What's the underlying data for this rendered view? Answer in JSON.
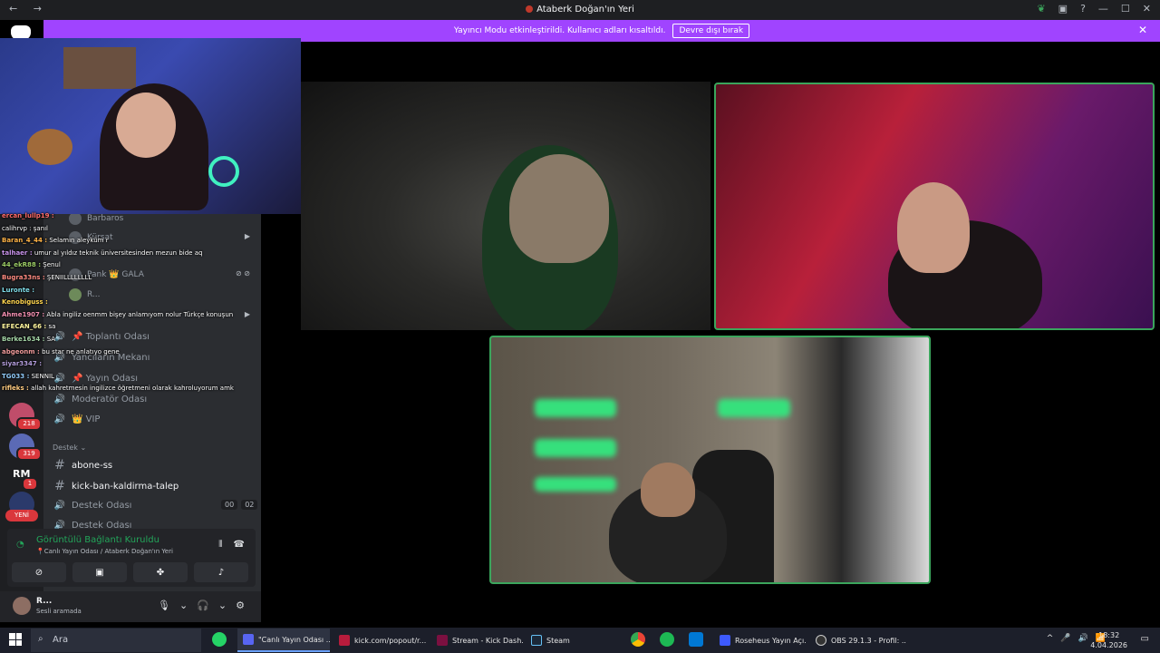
{
  "window": {
    "title": "Ataberk Doğan'ın Yeri",
    "nav_back": "←",
    "nav_forward": "→",
    "controls": [
      "—",
      "☐",
      "✕"
    ]
  },
  "banner": {
    "message": "Yayıncı Modu etkinleştirildi. Kullanıcı adları kısaltıldı.",
    "button": "Devre dışı bırak",
    "close": "✕"
  },
  "server_rail": {
    "badges": [
      "218",
      "319",
      "1"
    ],
    "text_icon": "RM",
    "new_label": "YENİ"
  },
  "channels": {
    "voice_users": [
      {
        "name": "Barbaros"
      },
      {
        "name": "Kürşat"
      },
      {
        "name": "Pank 👑 GALA"
      },
      {
        "name": "R..."
      }
    ],
    "voice_channels_upper": [
      {
        "label": "📌 Toplantı Odası"
      },
      {
        "label": "Yancıların Mekanı"
      },
      {
        "label": "📌 Yayın Odası"
      },
      {
        "label": "Moderatör Odası"
      },
      {
        "label": "👑 VIP"
      }
    ],
    "category": "Destek",
    "text_channels": [
      {
        "label": "abone-ss"
      },
      {
        "label": "kick-ban-kaldirma-talep"
      }
    ],
    "voice_channels_lower": [
      {
        "label": "Destek Odası"
      },
      {
        "label": "Destek Odası"
      }
    ],
    "destek_counts": [
      "00",
      "02"
    ]
  },
  "voice_panel": {
    "status": "Görüntülü Bağlantı Kuruldu",
    "location": "📍Canlı Yayın Odası / Ataberk Doğan'ın Yeri"
  },
  "user_panel": {
    "name": "R...",
    "status": "Sesli aramada"
  },
  "chat": [
    {
      "user": "ercan_lullp19 :",
      "msg": "",
      "color": "#ff6b6b"
    },
    {
      "user": "",
      "msg": "calihrvp : şanıl",
      "color": "#7ec8ff"
    },
    {
      "user": "Baran_4_44 :",
      "msg": "Selamın aleyküm r",
      "color": "#ffb347"
    },
    {
      "user": "talhaer :",
      "msg": "umur al yıldız teknik üniversitesinden mezun bide aq",
      "color": "#c792ea"
    },
    {
      "user": "44_ekR88 :",
      "msg": "Şenul",
      "color": "#9ccc65"
    },
    {
      "user": "Bugra33ns :",
      "msg": "ŞENIILLLLLLLL",
      "color": "#ff8a80"
    },
    {
      "user": "Luronte :",
      "msg": "",
      "color": "#80deea"
    },
    {
      "user": "Kenobiguss :",
      "msg": "",
      "color": "#ffd54f"
    },
    {
      "user": "Ahme1907 :",
      "msg": "Abla ingiliz oenmm bişey anlamıyom nolur Türkçe konuşun",
      "color": "#f48fb1"
    },
    {
      "user": "EFECAN_66 :",
      "msg": "sa",
      "color": "#fff59d"
    },
    {
      "user": "Berke1634 :",
      "msg": "SA",
      "color": "#a5d6a7"
    },
    {
      "user": "abgeonm :",
      "msg": "bu star ne anlatıyo gene",
      "color": "#ef9a9a"
    },
    {
      "user": "siyar3347 :",
      "msg": "",
      "color": "#b39ddb"
    },
    {
      "user": "TG033 :",
      "msg": "SENNIL",
      "color": "#90caf9"
    },
    {
      "user": "rifleks :",
      "msg": "allah kahretmesin ingilizce öğretmeni olarak kahroluyorum amk",
      "color": "#ffcc80"
    }
  ],
  "taskbar": {
    "search": "Ara",
    "apps": [
      {
        "label": "\"Canlı Yayın Odası ...",
        "color": "#5865f2"
      },
      {
        "label": "kick.com/popout/r...",
        "color": "#b71c3c"
      },
      {
        "label": "Stream - Kick Dash...",
        "color": "#7b1040"
      },
      {
        "label": "Steam",
        "color": "#1b2838"
      },
      {
        "label": "Roseheus Yayın Açı...",
        "color": "#3d5afe"
      },
      {
        "label": "OBS 29.1.3 - Profil: ...",
        "color": "#333"
      }
    ],
    "time": "18:32",
    "date": "4.04.2026",
    "tray": [
      "^",
      "🎤",
      "🔊",
      "📶"
    ]
  },
  "colors": {
    "banner": "#a044ff",
    "connected": "#23a55a",
    "speaking_border": "#3ba55c",
    "badge": "#da373c"
  }
}
